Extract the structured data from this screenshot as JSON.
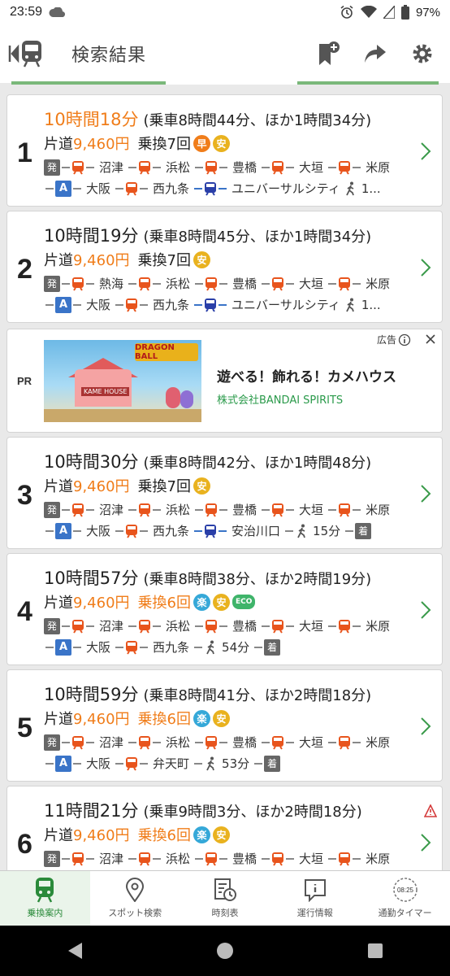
{
  "status": {
    "time": "23:59",
    "battery": "97%"
  },
  "appbar": {
    "title": "検索結果"
  },
  "results": [
    {
      "index": "1",
      "duration": "10時間18分",
      "detail": "(乗車8時間44分、ほか1時間34分)",
      "fare_label": "片道",
      "fare": "9,460円",
      "transfers": "乗換7回",
      "badges": [
        "早",
        "安"
      ],
      "route1": [
        "発",
        "沼津",
        "浜松",
        "豊橋",
        "大垣",
        "米原"
      ],
      "route2": [
        "A",
        "大阪",
        "西九条",
        "ユニバーサルシティ",
        "1..."
      ]
    },
    {
      "index": "2",
      "duration": "10時間19分",
      "detail": "(乗車8時間45分、ほか1時間34分)",
      "fare_label": "片道",
      "fare": "9,460円",
      "transfers": "乗換7回",
      "badges": [
        "安"
      ],
      "route1": [
        "発",
        "熱海",
        "浜松",
        "豊橋",
        "大垣",
        "米原"
      ],
      "route2": [
        "A",
        "大阪",
        "西九条",
        "ユニバーサルシティ",
        "1..."
      ]
    },
    {
      "index": "3",
      "duration": "10時間30分",
      "detail": "(乗車8時間42分、ほか1時間48分)",
      "fare_label": "片道",
      "fare": "9,460円",
      "transfers": "乗換7回",
      "badges": [
        "安"
      ],
      "route1": [
        "発",
        "沼津",
        "浜松",
        "豊橋",
        "大垣",
        "米原"
      ],
      "route2": [
        "A",
        "大阪",
        "西九条",
        "安治川口",
        "15分",
        "着"
      ]
    },
    {
      "index": "4",
      "duration": "10時間57分",
      "detail": "(乗車8時間38分、ほか2時間19分)",
      "fare_label": "片道",
      "fare": "9,460円",
      "transfers": "乗換6回",
      "badges": [
        "楽",
        "安",
        "ECO"
      ],
      "route1": [
        "発",
        "沼津",
        "浜松",
        "豊橋",
        "大垣",
        "米原"
      ],
      "route2": [
        "A",
        "大阪",
        "西九条",
        "54分",
        "着"
      ]
    },
    {
      "index": "5",
      "duration": "10時間59分",
      "detail": "(乗車8時間41分、ほか2時間18分)",
      "fare_label": "片道",
      "fare": "9,460円",
      "transfers": "乗換6回",
      "badges": [
        "楽",
        "安"
      ],
      "route1": [
        "発",
        "沼津",
        "浜松",
        "豊橋",
        "大垣",
        "米原"
      ],
      "route2": [
        "A",
        "大阪",
        "弁天町",
        "53分",
        "着"
      ]
    },
    {
      "index": "6",
      "duration": "11時間21分",
      "detail": "(乗車9時間3分、ほか2時間18分)",
      "fare_label": "片道",
      "fare": "9,460円",
      "transfers": "乗換6回",
      "badges": [
        "楽",
        "安"
      ],
      "route1": [
        "発",
        "沼津",
        "浜松",
        "豊橋",
        "大垣",
        "米原"
      ]
    }
  ],
  "ad": {
    "pr": "PR",
    "label": "広告",
    "headline": "遊べる！飾れる！カメハウス",
    "sponsor": "株式会社BANDAI SPIRITS",
    "image_logo": "DRAGON BALL",
    "image_sign": "KAME HOUSE"
  },
  "bottom_nav": [
    {
      "label": "乗換案内",
      "icon": "train-icon",
      "active": true
    },
    {
      "label": "スポット検索",
      "icon": "map-pin-icon"
    },
    {
      "label": "時刻表",
      "icon": "timetable-icon"
    },
    {
      "label": "運行情報",
      "icon": "info-icon"
    },
    {
      "label": "通勤タイマー",
      "icon": "timer-icon",
      "timer_text": "08:25"
    }
  ],
  "colors": {
    "orange": "#f07d1a",
    "green": "#2a8a3a",
    "yellow": "#e9b21f",
    "blue": "#35a8d8"
  }
}
